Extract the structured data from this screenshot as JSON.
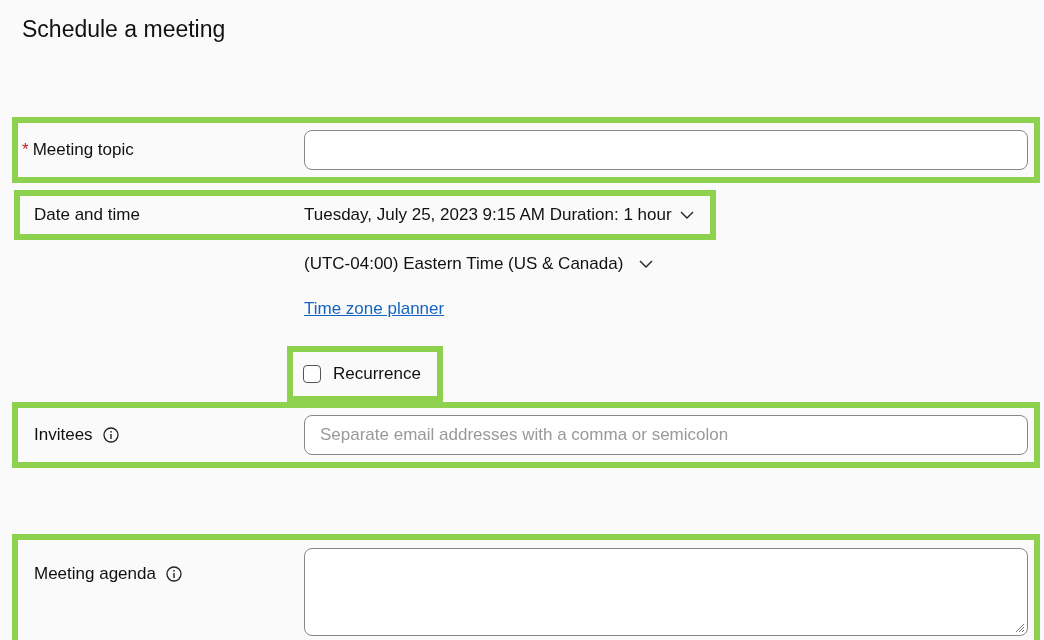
{
  "title": "Schedule a meeting",
  "fields": [
    {
      "kind": "text",
      "label": "Meeting topic",
      "required_mark": "*",
      "info": false,
      "highlighted": true
    },
    {
      "kind": "datetime",
      "label": "Date and time",
      "value": "Tuesday, July 25, 2023 9:15 AM Duration: 1 hour",
      "highlighted": true
    },
    {
      "kind": "timezone",
      "value": "(UTC-04:00) Eastern Time (US & Canada)",
      "highlighted": false
    },
    {
      "kind": "link",
      "text": "Time zone planner",
      "highlighted": false
    },
    {
      "kind": "checkbox",
      "label": "Recurrence",
      "checked": false,
      "highlighted": true
    },
    {
      "kind": "text",
      "label": "Invitees",
      "info": true,
      "placeholder": "Separate email addresses with a comma or semicolon",
      "highlighted": true
    },
    {
      "kind": "textarea",
      "label": "Meeting agenda",
      "info": true,
      "highlighted": true
    }
  ]
}
